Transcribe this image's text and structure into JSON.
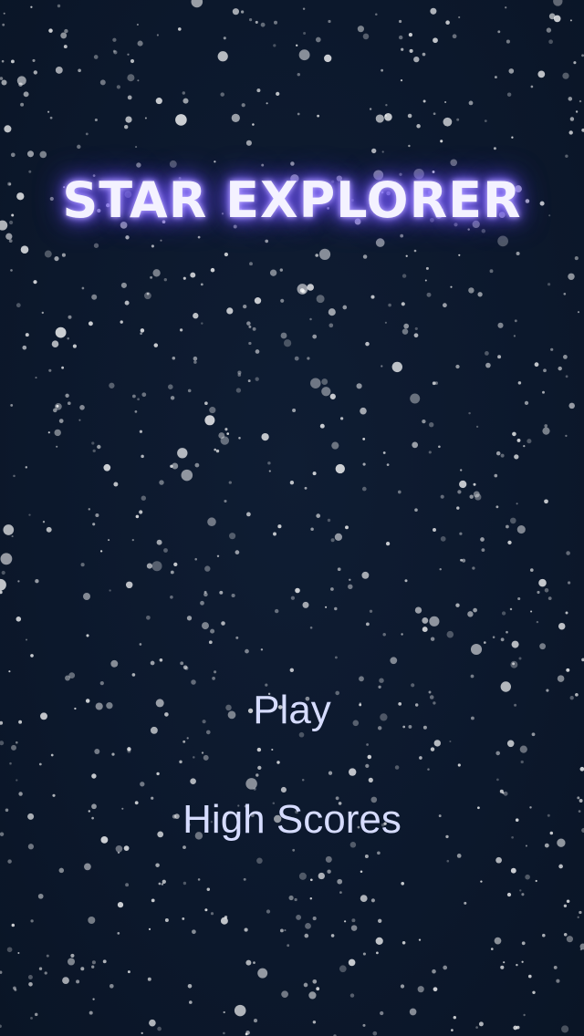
{
  "game": {
    "title": "STAR EXPLORER"
  },
  "menu": {
    "play_label": "Play",
    "high_scores_label": "High Scores"
  },
  "colors": {
    "background": "#0d1a2e",
    "title_glow": "#6c52ff",
    "menu_text": "#d6dcff",
    "star": "#ffffff"
  }
}
